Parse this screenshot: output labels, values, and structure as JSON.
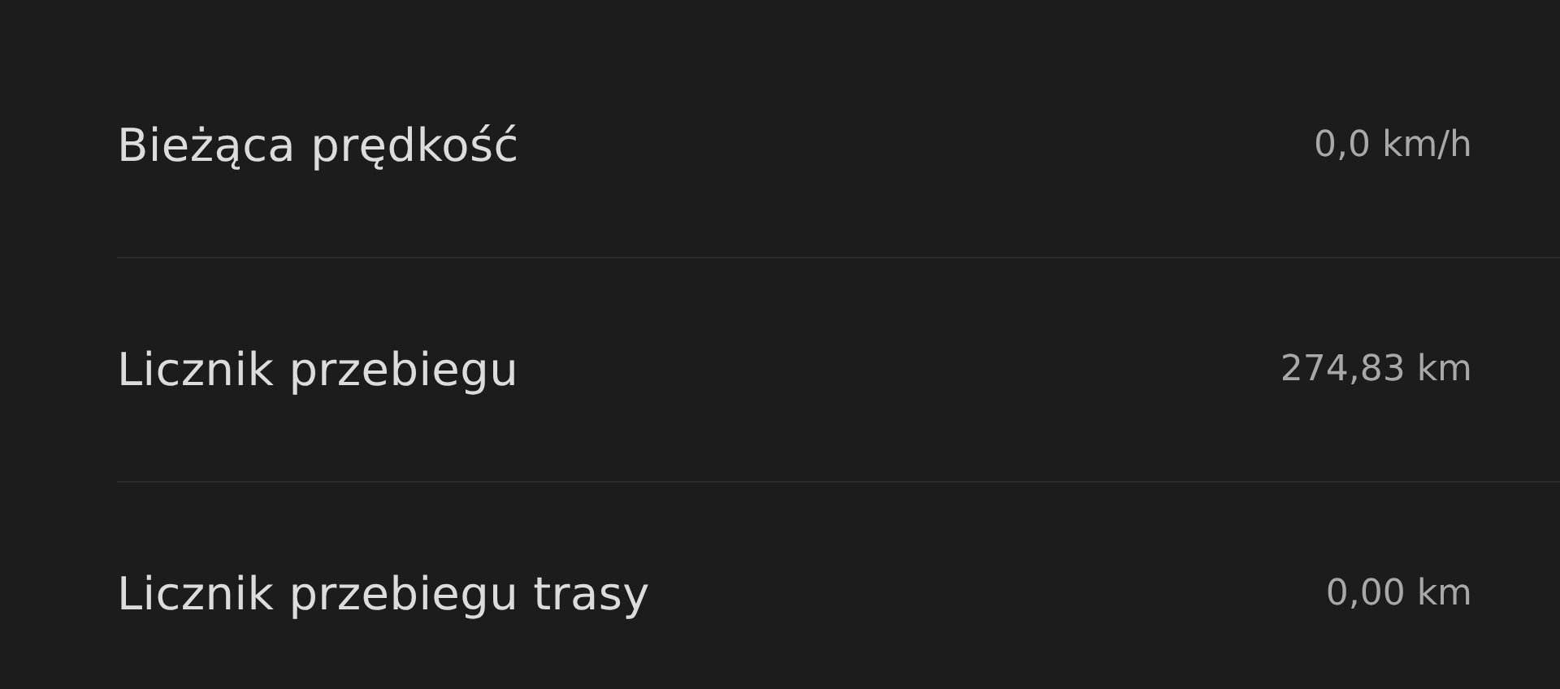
{
  "rows": [
    {
      "label": "Bieżąca prędkość",
      "value": "0,0 km/h"
    },
    {
      "label": "Licznik przebiegu",
      "value": "274,83 km"
    },
    {
      "label": "Licznik przebiegu trasy",
      "value": "0,00 km"
    }
  ]
}
